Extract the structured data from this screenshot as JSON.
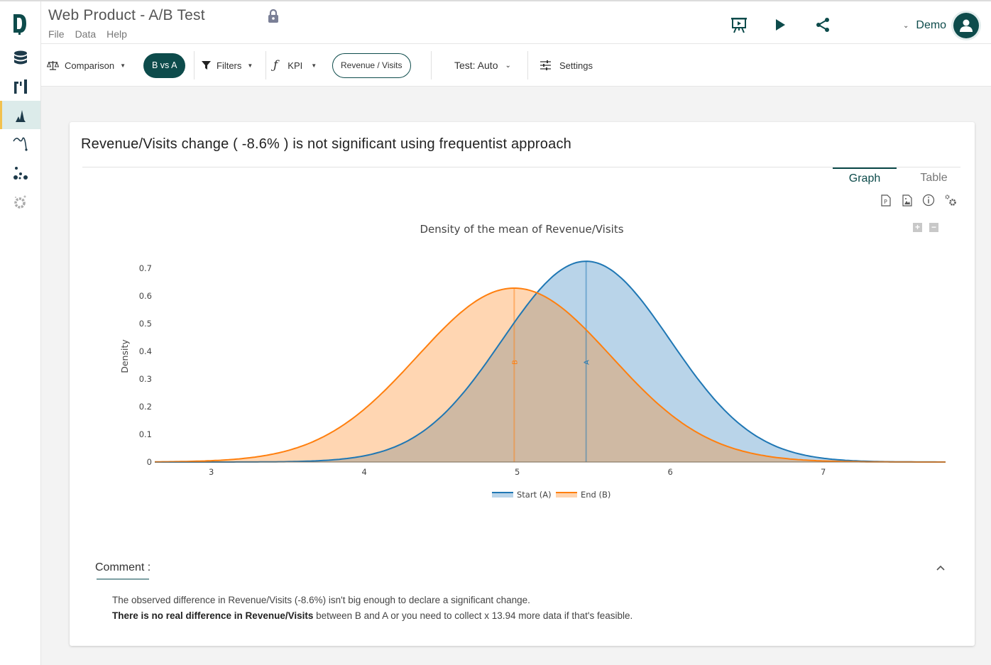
{
  "app": {
    "title": "Web Product - A/B Test",
    "menu": [
      "File",
      "Data",
      "Help"
    ],
    "user_name": "Demo",
    "header_icons": [
      "presentation-icon",
      "play-icon",
      "share-icon"
    ]
  },
  "sidebar": {
    "items": [
      {
        "name": "database",
        "icon": "database-icon",
        "active": false
      },
      {
        "name": "columns",
        "icon": "columns-icon",
        "active": false
      },
      {
        "name": "density",
        "icon": "density-icon",
        "active": true
      },
      {
        "name": "trend",
        "icon": "trend-icon",
        "active": false
      },
      {
        "name": "scatter",
        "icon": "scatter-icon",
        "active": false
      },
      {
        "name": "settings-gear",
        "icon": "gear-icon",
        "active": false
      }
    ]
  },
  "toolbar": {
    "comparison_label": "Comparison",
    "comparison_value": "B vs A",
    "filters_label": "Filters",
    "kpi_label": "KPI",
    "kpi_value": "Revenue / Visits",
    "test_label": "Test: Auto",
    "settings_label": "Settings"
  },
  "card": {
    "title": "Revenue/Visits change ( -8.6% ) is not significant using frequentist approach",
    "tabs": [
      {
        "label": "Graph",
        "active": true
      },
      {
        "label": "Table",
        "active": false
      }
    ],
    "tool_icons": [
      "pdf-export-icon",
      "image-export-icon",
      "info-icon",
      "settings-cogs-icon"
    ],
    "zoom_in": "+",
    "zoom_out": "−"
  },
  "chart_data": {
    "type": "area",
    "title": "Density of the mean of Revenue/Visits",
    "xlabel": "",
    "ylabel": "Density",
    "xlim": [
      2.63,
      7.8
    ],
    "ylim": [
      0,
      0.7
    ],
    "xticks": [
      3,
      4,
      5,
      6,
      7
    ],
    "yticks": [
      0,
      0.1,
      0.2,
      0.3,
      0.4,
      0.5,
      0.6,
      0.7
    ],
    "grid": false,
    "legend_position": "bottom-center",
    "series": [
      {
        "name": "Start (A)",
        "marker_label": "A",
        "distribution": "normal",
        "mean": 5.45,
        "std": 0.55,
        "peak_density": 0.726,
        "color": "#1f77b4",
        "fill": "#b9d4e9"
      },
      {
        "name": "End (B)",
        "marker_label": "B",
        "distribution": "normal",
        "mean": 4.98,
        "std": 0.635,
        "peak_density": 0.628,
        "color": "#ff7f0e",
        "fill": "#ffd3ad"
      }
    ],
    "overlap_fill": "#cfb9a2"
  },
  "comment": {
    "label": "Comment :",
    "line1": "The observed difference in Revenue/Visits (-8.6%) isn't big enough to declare a significant change.",
    "line2_bold": "There is no real difference in Revenue/Visits",
    "line2_rest": " between B and A or you need to collect x 13.94 more data if that's feasible."
  }
}
